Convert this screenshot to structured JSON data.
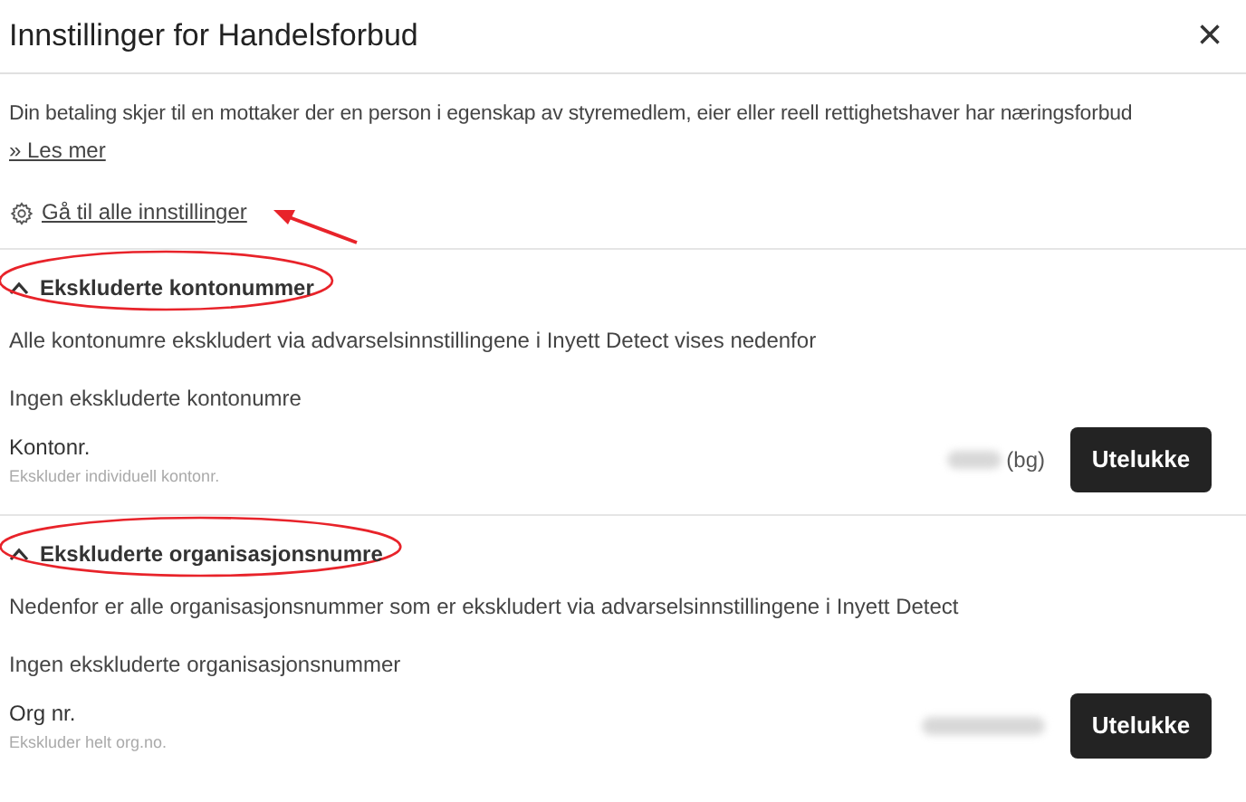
{
  "window": {
    "title": "Innstillinger for Handelsforbud",
    "close": "×"
  },
  "intro": {
    "text": "Din betaling skjer til en mottaker der en person i egenskap av styremedlem, eier eller reell rettighetshaver har næringsforbud",
    "link": "» Les mer"
  },
  "settings_link": {
    "label": "Gå til alle innstillinger",
    "annotated": true
  },
  "sections": [
    {
      "title": "Ekskluderte kontonummer",
      "expanded": true,
      "annotated": true,
      "description": "Alle kontonumre ekskludert via advarselsinnstillingene i Inyett Detect vises nedenfor",
      "empty": "Ingen ekskluderte kontonumre",
      "field": {
        "label": "Kontonr.",
        "hint": "Ekskluder individuell kontonr.",
        "suffix": "(bg)",
        "value_hidden": true
      },
      "button": "Utelukke"
    },
    {
      "title": "Ekskluderte organisasjonsnumre",
      "expanded": true,
      "annotated": true,
      "description": "Nedenfor er alle organisasjonsnummer som er ekskludert via advarselsinnstillingene i Inyett Detect",
      "empty": "Ingen ekskluderte organisasjonsnummer",
      "field": {
        "label": "Org nr.",
        "hint": "Ekskluder helt org.no.",
        "value_hidden": true
      },
      "button": "Utelukke"
    }
  ]
}
